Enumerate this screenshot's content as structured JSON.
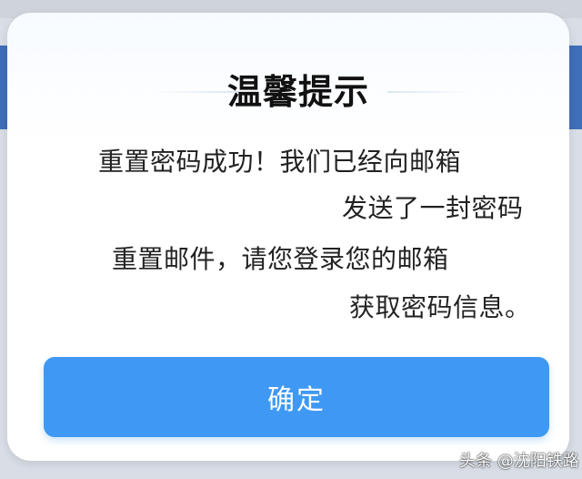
{
  "dialog": {
    "title": "温馨提示",
    "message_lines": [
      "重置密码成功！我们已经向邮箱",
      "发送了一封密码",
      "重置邮件，请您登录您的邮箱",
      "获取密码信息。"
    ],
    "confirm_label": "确定"
  },
  "watermark": {
    "text": "头条 @沈阳铁路"
  },
  "colors": {
    "primary_button": "#3f99f4",
    "dialog_background": "#ffffff",
    "backdrop_band": "#3f6fb8"
  }
}
